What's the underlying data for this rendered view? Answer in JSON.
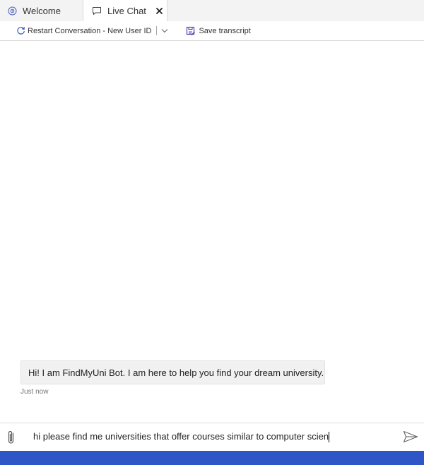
{
  "tabs": {
    "welcome": {
      "label": "Welcome",
      "icon": "globe-icon"
    },
    "chat": {
      "label": "Live Chat",
      "icon": "chat-bubble-icon",
      "close_glyph": "✕"
    }
  },
  "toolbar": {
    "restart_label": "Restart Conversation - New User ID",
    "save_label": "Save transcript"
  },
  "chat": {
    "messages": [
      {
        "sender": "bot",
        "text": "Hi! I am FindMyUni Bot. I am here to help you find your dream university.",
        "timestamp": "Just now"
      }
    ]
  },
  "input": {
    "value": "hi please find me universities that offer courses similar to computer scien"
  },
  "colors": {
    "status_bar": "#2f56c7",
    "bot_bubble": "#f1f1f1",
    "save_icon": "#5a3fb0"
  }
}
